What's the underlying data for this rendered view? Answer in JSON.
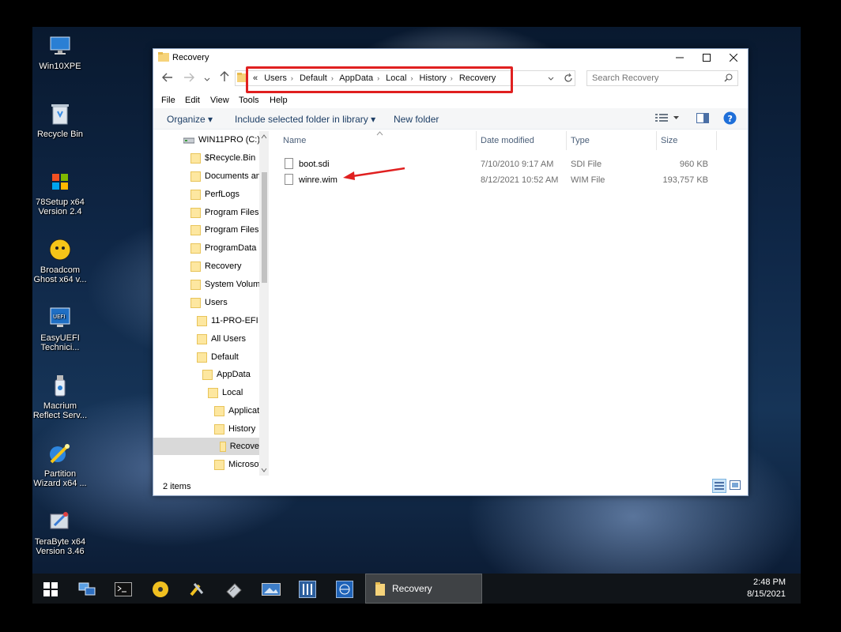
{
  "desktop": {
    "icons": [
      {
        "label": "Win10XPE"
      },
      {
        "label": "Recycle Bin"
      },
      {
        "label": "78Setup x64 Version 2.4"
      },
      {
        "label": "Broadcom Ghost x64 v..."
      },
      {
        "label": "EasyUEFI Technici..."
      },
      {
        "label": "Macrium Reflect Serv..."
      },
      {
        "label": "Partition Wizard x64 ..."
      },
      {
        "label": "TeraByte x64 Version 3.46"
      }
    ]
  },
  "window": {
    "title": "Recovery",
    "address": {
      "prefix": "«",
      "crumbs": [
        "Users",
        "Default",
        "AppData",
        "Local",
        "History",
        "Recovery"
      ]
    },
    "search_placeholder": "Search Recovery",
    "menu": [
      "File",
      "Edit",
      "View",
      "Tools",
      "Help"
    ],
    "commands": {
      "organize": "Organize",
      "include": "Include selected folder in library",
      "new_folder": "New folder"
    },
    "tree": [
      {
        "label": "WIN11PRO (C:)"
      },
      {
        "label": "$Recycle.Bin"
      },
      {
        "label": "Documents and"
      },
      {
        "label": "PerfLogs"
      },
      {
        "label": "Program Files"
      },
      {
        "label": "Program Files ("
      },
      {
        "label": "ProgramData"
      },
      {
        "label": "Recovery"
      },
      {
        "label": "System Volume"
      },
      {
        "label": "Users"
      },
      {
        "label": "11-PRO-EFI"
      },
      {
        "label": "All Users"
      },
      {
        "label": "Default"
      },
      {
        "label": "AppData"
      },
      {
        "label": "Local"
      },
      {
        "label": "Applicati"
      },
      {
        "label": "History"
      },
      {
        "label": "Recove"
      },
      {
        "label": "Microsof"
      }
    ],
    "columns": {
      "name": "Name",
      "date": "Date modified",
      "type": "Type",
      "size": "Size"
    },
    "files": [
      {
        "name": "boot.sdi",
        "date": "7/10/2010 9:17 AM",
        "type": "SDI File",
        "size": "960 KB"
      },
      {
        "name": "winre.wim",
        "date": "8/12/2021 10:52 AM",
        "type": "WIM File",
        "size": "193,757 KB"
      }
    ],
    "status": "2 items"
  },
  "taskbar": {
    "active_task": "Recovery",
    "time": "2:48 PM",
    "date": "8/15/2021"
  },
  "colors": {
    "accent": "#1e6fd9",
    "highlight_box": "#e02020",
    "taskbar": "#101418"
  }
}
